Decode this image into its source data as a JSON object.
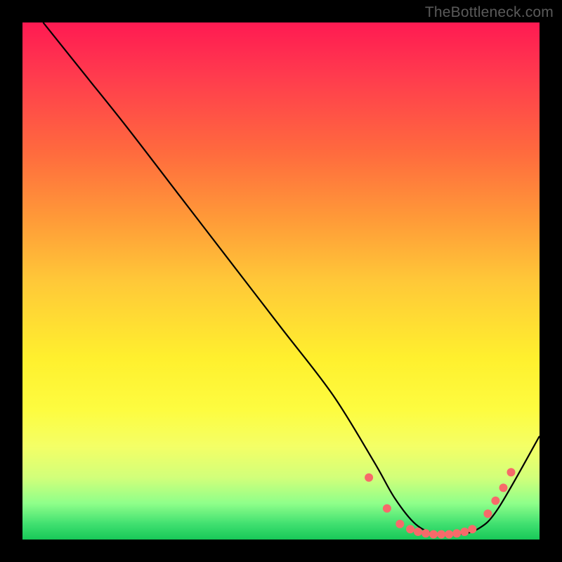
{
  "watermark": "TheBottleneck.com",
  "chart_data": {
    "type": "line",
    "title": "",
    "xlabel": "",
    "ylabel": "",
    "xlim": [
      0,
      100
    ],
    "ylim": [
      0,
      100
    ],
    "series": [
      {
        "name": "curve",
        "x": [
          4,
          12,
          20,
          30,
          40,
          50,
          60,
          68,
          72,
          76,
          80,
          84,
          88,
          92,
          100
        ],
        "y": [
          100,
          90,
          80,
          67,
          54,
          41,
          28,
          15,
          8,
          3,
          1,
          1,
          2,
          6,
          20
        ]
      }
    ],
    "markers": {
      "name": "dots",
      "x": [
        67,
        70.5,
        73,
        75,
        76.5,
        78,
        79.5,
        81,
        82.5,
        84,
        85.5,
        87,
        90,
        91.5,
        93,
        94.5
      ],
      "y": [
        12,
        6,
        3,
        2,
        1.5,
        1.2,
        1.0,
        1.0,
        1.0,
        1.2,
        1.5,
        2.0,
        5.0,
        7.5,
        10,
        13
      ]
    },
    "colors": {
      "curve": "#000000",
      "marker": "#f76a6a"
    }
  }
}
